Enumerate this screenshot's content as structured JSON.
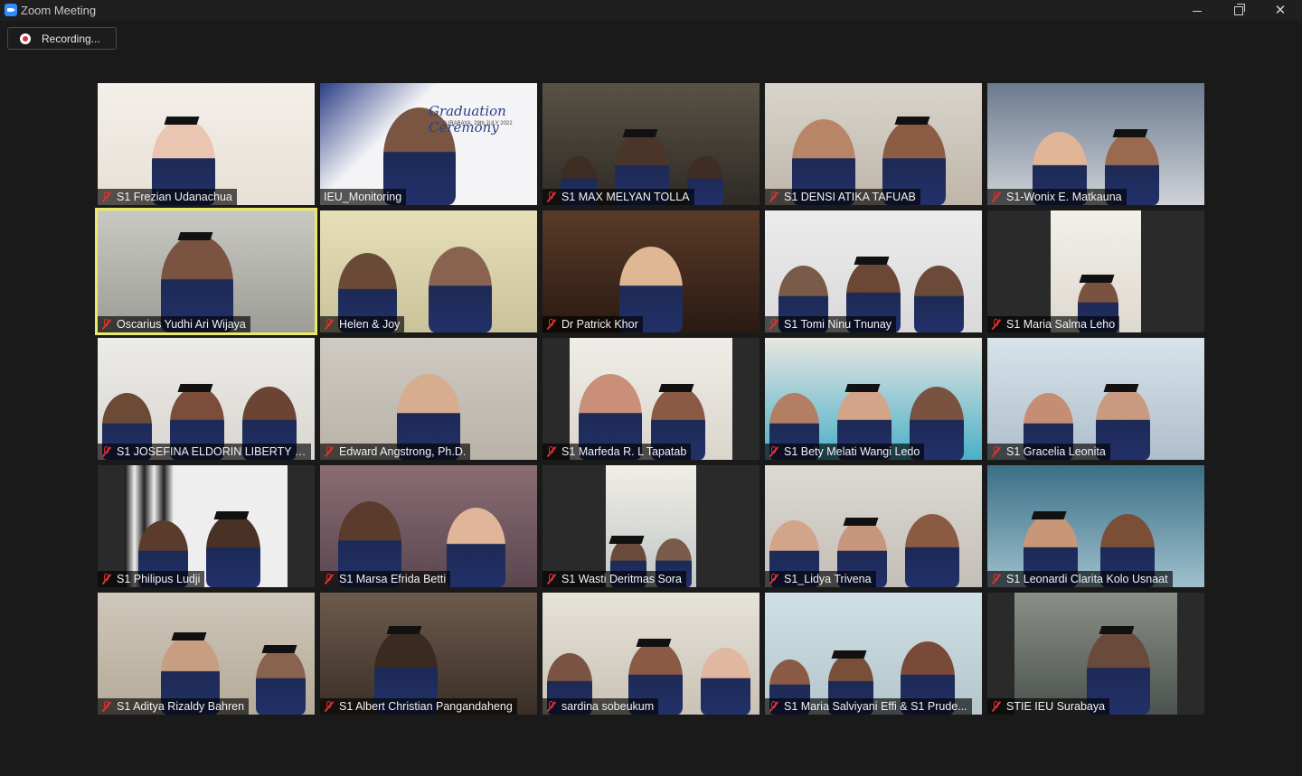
{
  "window": {
    "title": "Zoom Meeting",
    "minimize_label": "",
    "maximize_label": "",
    "close_label": "✕"
  },
  "recording": {
    "label": "Recording..."
  },
  "colors": {
    "active_speaker": "#e9ea67",
    "mute": "#e0312f",
    "background": "#1a1a1a"
  },
  "participants": [
    {
      "name": "S1 Frezian Udanachua",
      "muted": true
    },
    {
      "name": "IEU_Monitoring",
      "muted": false
    },
    {
      "name": "S1 MAX MELYAN TOLLA",
      "muted": true
    },
    {
      "name": "S1 DENSI ATIKA TAFUAB",
      "muted": true
    },
    {
      "name": "S1-Wonix E. Matkauna",
      "muted": true
    },
    {
      "name": "Oscarius Yudhi Ari Wijaya",
      "muted": true,
      "active": true
    },
    {
      "name": "Helen & Joy",
      "muted": true
    },
    {
      "name": "Dr Patrick Khor",
      "muted": true
    },
    {
      "name": "S1 Tomi Ninu Tnunay",
      "muted": true
    },
    {
      "name": "S1 Maria Salma Leho",
      "muted": true
    },
    {
      "name": "S1 JOSEFINA ELDORIN LIBERTY BER...",
      "muted": true
    },
    {
      "name": "Edward Angstrong, Ph.D.",
      "muted": true
    },
    {
      "name": "S1 Marfeda R. L Tapatab",
      "muted": true
    },
    {
      "name": "S1 Bety Melati Wangi Ledo",
      "muted": true
    },
    {
      "name": "S1 Gracelia Leonita",
      "muted": true
    },
    {
      "name": "S1 Philipus Ludji",
      "muted": true
    },
    {
      "name": "S1 Marsa Efrida Betti",
      "muted": true
    },
    {
      "name": "S1 Wasti Deritmas Sora",
      "muted": true
    },
    {
      "name": "S1_Lidya Trivena",
      "muted": true
    },
    {
      "name": "S1 Leonardi Clarita Kolo Usnaat",
      "muted": true
    },
    {
      "name": "S1 Aditya Rizaldy Bahren",
      "muted": true
    },
    {
      "name": "S1 Albert Christian Pangandaheng",
      "muted": true
    },
    {
      "name": "sardina sobeukum",
      "muted": true
    },
    {
      "name": "S1 Maria Salviyani Effi & S1  Prude...",
      "muted": true
    },
    {
      "name": "STIE IEU Surabaya",
      "muted": true
    }
  ],
  "monitoring_banner": {
    "title": "Graduation Ceremony",
    "subtitle": "SURABAYA, 29th JULY 2022"
  }
}
